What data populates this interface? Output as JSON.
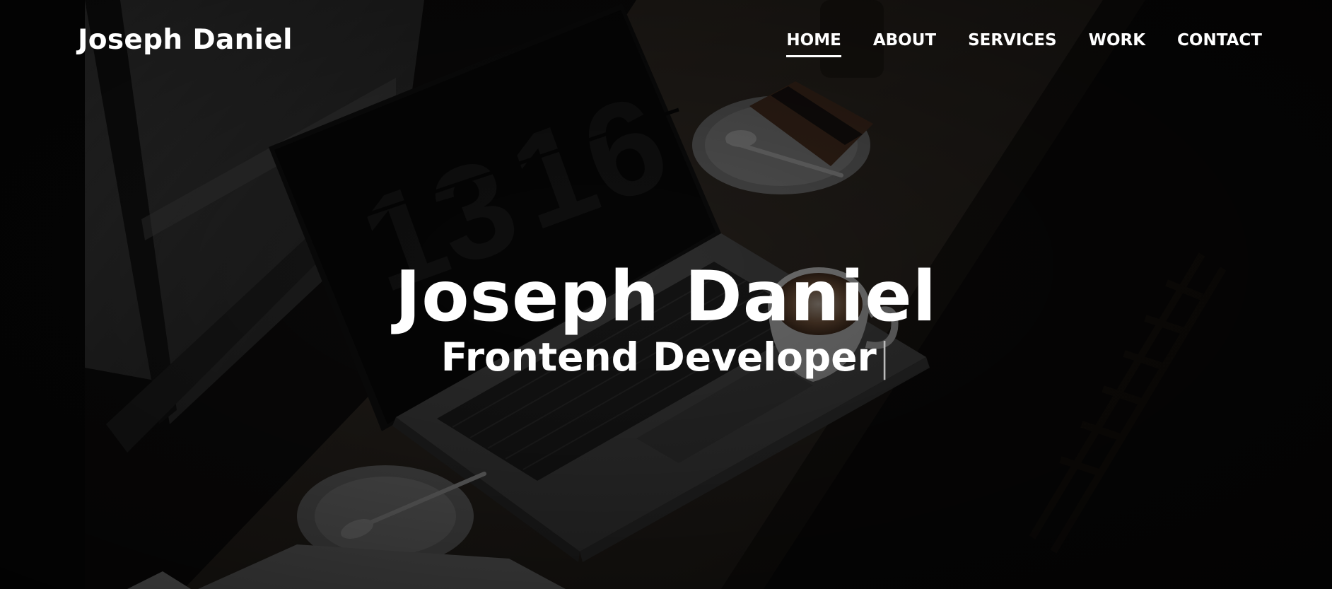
{
  "site": {
    "brand": "Joseph Daniel"
  },
  "nav": {
    "items": [
      {
        "label": "HOME",
        "active": true
      },
      {
        "label": "ABOUT",
        "active": false
      },
      {
        "label": "SERVICES",
        "active": false
      },
      {
        "label": "WORK",
        "active": false
      },
      {
        "label": "CONTACT",
        "active": false
      }
    ]
  },
  "hero": {
    "title": "Joseph Daniel",
    "subtitle": "Frontend Developer",
    "caret": "|",
    "laptop_clock": [
      "13",
      "16"
    ]
  },
  "colors": {
    "text": "#ffffff",
    "overlay": "#000000",
    "background": "#0d0c0b"
  }
}
